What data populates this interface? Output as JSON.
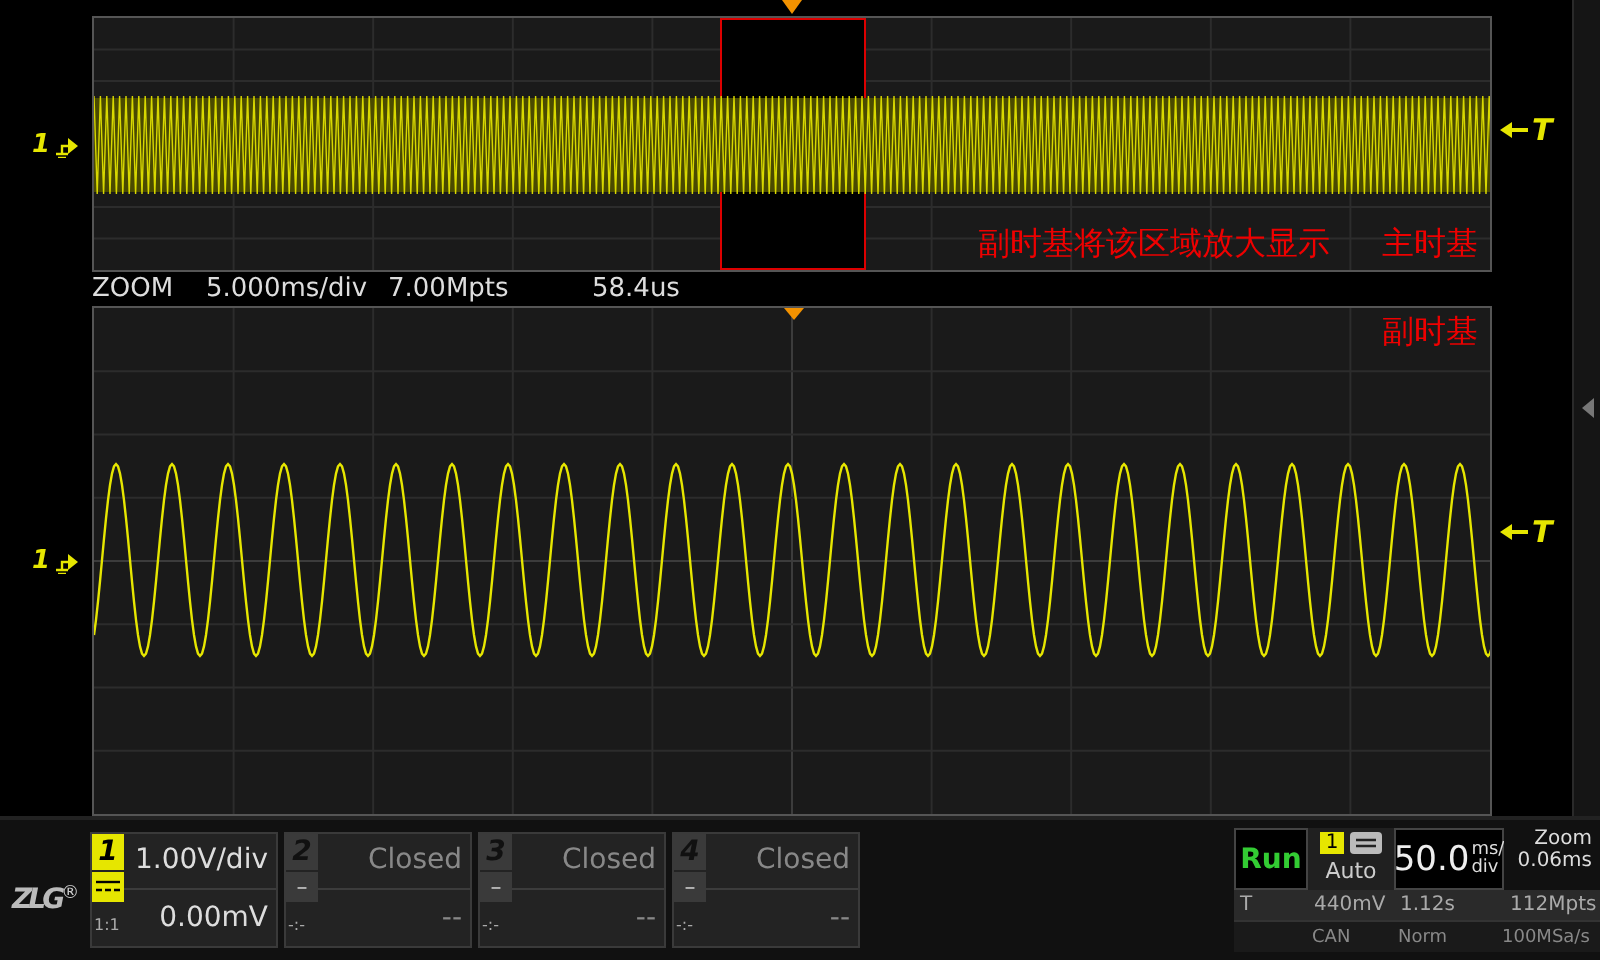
{
  "main_view": {
    "channel_marker": "1",
    "trigger_label": "T",
    "annotations": [
      "副时基将该区域放大显示",
      "主时基"
    ]
  },
  "zoom_bar": {
    "label": "ZOOM",
    "timebase": "5.000ms/div",
    "memory": "7.00Mpts",
    "offset": "58.4us"
  },
  "zoom_view": {
    "label": "副时基",
    "channel_marker": "1",
    "trigger_label": "T"
  },
  "logo": {
    "text": "ZLG",
    "mark": "®"
  },
  "channels": [
    {
      "number": "1",
      "on": true,
      "probe": "1:1",
      "scale": "1.00V/div",
      "offset": "0.00mV"
    },
    {
      "number": "2",
      "on": false,
      "coupling": "–",
      "probe": "-:-",
      "scale": "Closed",
      "offset": "--"
    },
    {
      "number": "3",
      "on": false,
      "coupling": "–",
      "probe": "-:-",
      "scale": "Closed",
      "offset": "--"
    },
    {
      "number": "4",
      "on": false,
      "coupling": "–",
      "probe": "-:-",
      "scale": "Closed",
      "offset": "--"
    }
  ],
  "status": {
    "run_state": "Run",
    "trigger_source": "1",
    "trigger_mode": "Auto",
    "timebase_value": "50.0",
    "timebase_unit_top": "ms/",
    "timebase_unit_bottom": "div",
    "zoom_label": "Zoom",
    "zoom_value": "0.06ms",
    "row_2": [
      "T",
      "440mV",
      "1.12s",
      "112Mpts"
    ],
    "row_3": [
      "CAN",
      "Norm",
      "100MSa/s"
    ]
  }
}
